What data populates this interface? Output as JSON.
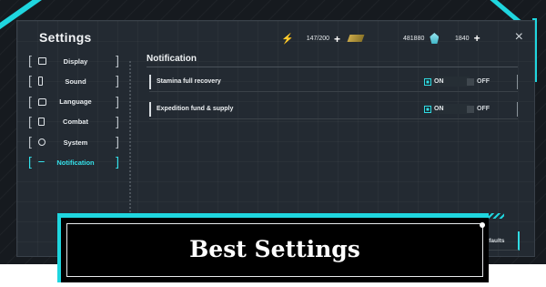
{
  "window": {
    "title": "Settings",
    "close_label": "×"
  },
  "resources": [
    {
      "icon": "bolt-icon",
      "value": "147/200",
      "add": "+"
    },
    {
      "icon": "ticket-icon",
      "value": "481880"
    },
    {
      "icon": "gem-icon",
      "value": "1840",
      "add": "+"
    }
  ],
  "sidebar": {
    "items": [
      {
        "label": "Display",
        "icon": "display-icon",
        "active": false
      },
      {
        "label": "Sound",
        "icon": "sound-icon",
        "active": false
      },
      {
        "label": "Language",
        "icon": "language-icon",
        "active": false
      },
      {
        "label": "Combat",
        "icon": "combat-icon",
        "active": false
      },
      {
        "label": "System",
        "icon": "system-icon",
        "active": false
      },
      {
        "label": "Notification",
        "icon": "notification-icon",
        "active": true
      }
    ]
  },
  "content": {
    "title": "Notification",
    "rows": [
      {
        "label": "Stamina full recovery",
        "on_label": "ON",
        "off_label": "OFF",
        "selected": "ON"
      },
      {
        "label": "Expedition fund & supply",
        "on_label": "ON",
        "off_label": "OFF",
        "selected": "ON"
      }
    ],
    "reset_label": "Reset to Defaults"
  },
  "banner": {
    "text": "Best Settings"
  },
  "colors": {
    "accent": "#1fd6df",
    "panel": "#232a32",
    "frame": "#161a1f"
  }
}
